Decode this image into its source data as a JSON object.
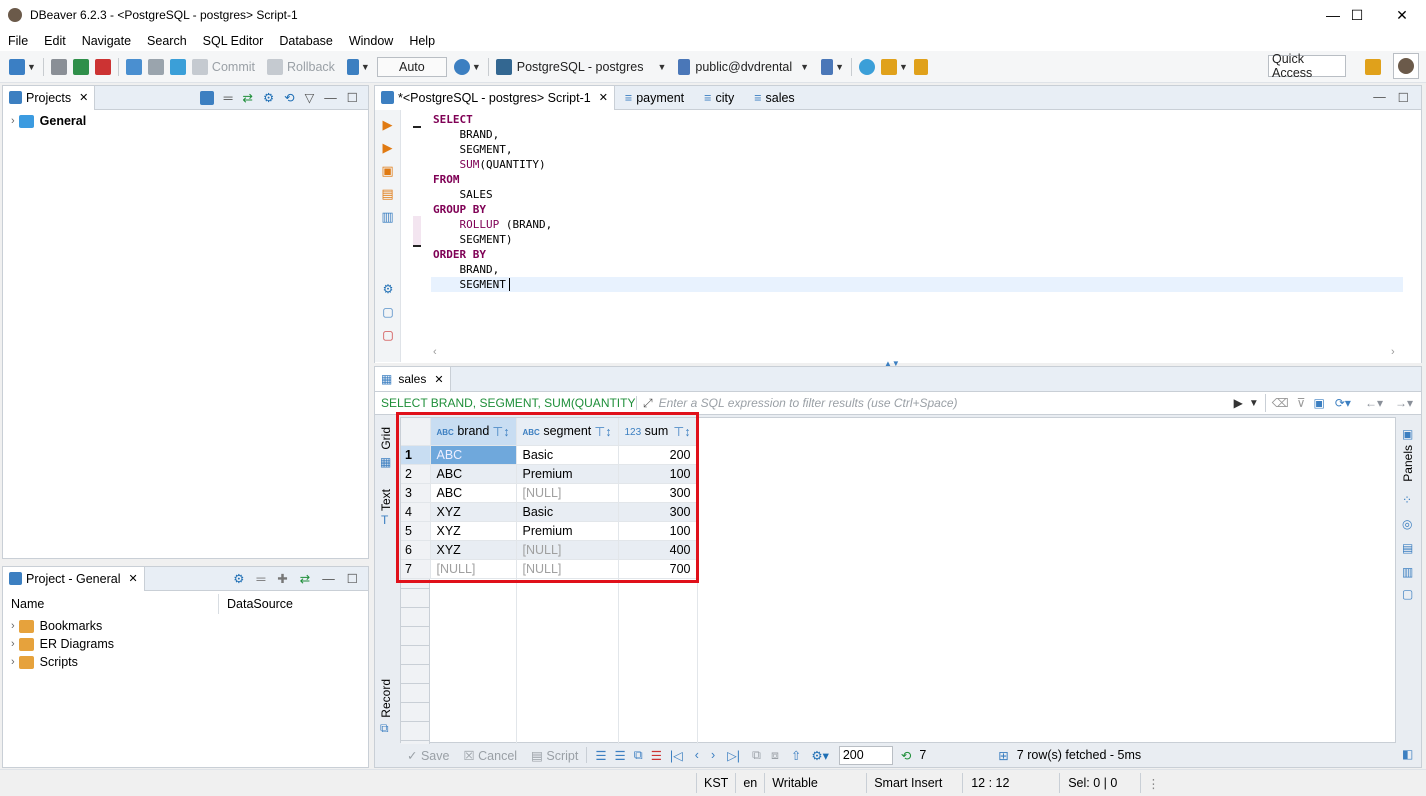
{
  "window": {
    "title": "DBeaver 6.2.3 - <PostgreSQL - postgres> Script-1",
    "minimize": "—",
    "maximize": "☐",
    "close": "✕"
  },
  "menu": [
    "File",
    "Edit",
    "Navigate",
    "Search",
    "SQL Editor",
    "Database",
    "Window",
    "Help"
  ],
  "toolbar": {
    "commit": "Commit",
    "rollback": "Rollback",
    "auto": "Auto",
    "connection": "PostgreSQL - postgres",
    "schema": "public@dvdrental",
    "quick_access": "Quick Access"
  },
  "projects_panel": {
    "tab": "Projects",
    "items": [
      "General"
    ]
  },
  "project_general_panel": {
    "tab": "Project - General",
    "col_name": "Name",
    "col_datasource": "DataSource",
    "items": [
      "Bookmarks",
      "ER Diagrams",
      "Scripts"
    ]
  },
  "editor_tabs": [
    "*<PostgreSQL - postgres> Script-1",
    "payment",
    "city",
    "sales"
  ],
  "sql_lines": [
    {
      "k": "SELECT",
      "t": ""
    },
    {
      "k": "",
      "t": "    BRAND,"
    },
    {
      "k": "",
      "t": "    SEGMENT,"
    },
    {
      "k": "",
      "t": "    ",
      "f": "SUM",
      "r": "(QUANTITY)"
    },
    {
      "k": "FROM",
      "t": ""
    },
    {
      "k": "",
      "t": "    SALES"
    },
    {
      "k": "GROUP BY",
      "t": ""
    },
    {
      "k": "",
      "t": "    ",
      "f": "ROLLUP",
      "r": " (BRAND,"
    },
    {
      "k": "",
      "t": "    SEGMENT)"
    },
    {
      "k": "ORDER BY",
      "t": ""
    },
    {
      "k": "",
      "t": "    BRAND,"
    },
    {
      "k": "",
      "t": "    SEGMENT"
    }
  ],
  "results": {
    "tab": "sales",
    "query_label": "SELECT BRAND, SEGMENT, SUM(QUANTITY",
    "filter_placeholder": "Enter a SQL expression to filter results (use Ctrl+Space)",
    "side_tabs": {
      "grid": "Grid",
      "text": "Text",
      "record": "Record",
      "panels": "Panels"
    },
    "columns": [
      {
        "type": "ABC",
        "name": "brand"
      },
      {
        "type": "ABC",
        "name": "segment"
      },
      {
        "type": "123",
        "name": "sum"
      }
    ],
    "rows": [
      {
        "n": "1",
        "brand": "ABC",
        "segment": "Basic",
        "sum": "200"
      },
      {
        "n": "2",
        "brand": "ABC",
        "segment": "Premium",
        "sum": "100"
      },
      {
        "n": "3",
        "brand": "ABC",
        "segment": "[NULL]",
        "sum": "300"
      },
      {
        "n": "4",
        "brand": "XYZ",
        "segment": "Basic",
        "sum": "300"
      },
      {
        "n": "5",
        "brand": "XYZ",
        "segment": "Premium",
        "sum": "100"
      },
      {
        "n": "6",
        "brand": "XYZ",
        "segment": "[NULL]",
        "sum": "400"
      },
      {
        "n": "7",
        "brand": "[NULL]",
        "segment": "[NULL]",
        "sum": "700"
      }
    ],
    "bottom": {
      "save": "Save",
      "cancel": "Cancel",
      "script": "Script",
      "fetch_size": "200",
      "row_count": "7",
      "status": "7 row(s) fetched - 5ms"
    }
  },
  "statusbar": {
    "tz": "KST",
    "lang": "en",
    "mode": "Writable",
    "insert": "Smart Insert",
    "pos": "12 : 12",
    "sel": "Sel: 0 | 0"
  },
  "colors": {
    "highlight": "#e0101a",
    "accent": "#3c7fc1"
  }
}
